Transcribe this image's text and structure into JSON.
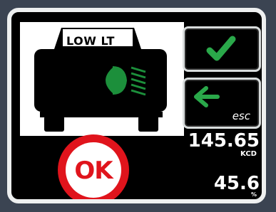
{
  "display": {
    "mode_label": "LOW LT"
  },
  "buttons": {
    "confirm_icon": "checkmark-icon",
    "escape_icon": "arrow-left-icon",
    "escape_label": "esc"
  },
  "readings": {
    "intensity_value": "145.65",
    "intensity_unit": "KCD",
    "percent_value": "45.6",
    "percent_unit": "%"
  },
  "status": {
    "badge_text": "OK"
  },
  "colors": {
    "background": "#3b4452",
    "screen": "#000000",
    "bezel": "#eef0f0",
    "lamp_green": "#1c8f3b",
    "check_green": "#2aa84a",
    "ok_red": "#e0141c"
  }
}
